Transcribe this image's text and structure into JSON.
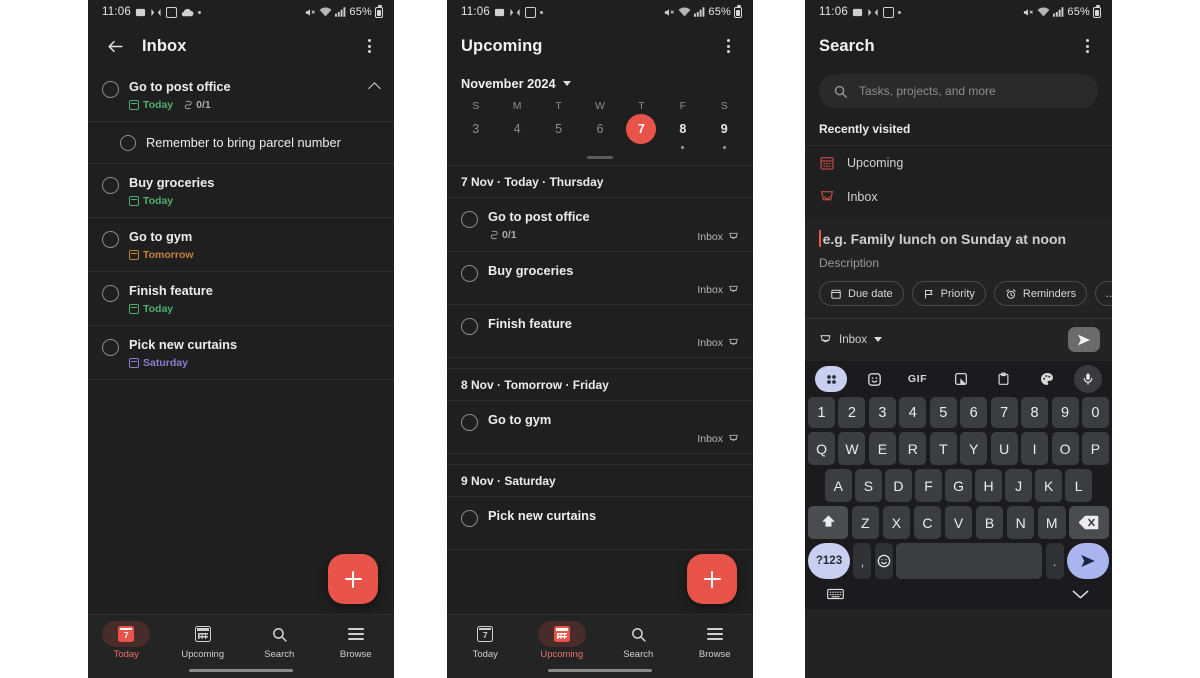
{
  "statusbar": {
    "time": "11:06",
    "battery": "65%",
    "icons": [
      "image-icon",
      "messages-icon",
      "calendar-icon",
      "cloud-icon",
      "dot-icon"
    ],
    "right_icons": [
      "mute-icon",
      "wifi-icon",
      "signal-icon",
      "battery-icon"
    ]
  },
  "panel_inbox": {
    "appbar": {
      "back": "back-arrow-icon",
      "title": "Inbox",
      "menu": "overflow-menu-icon"
    },
    "tasks": [
      {
        "name": "Go to post office",
        "date": "Today",
        "date_color": "green",
        "subcount": "0/1",
        "expanded": true,
        "sub": false
      },
      {
        "name": "Remember to bring parcel number",
        "date": "",
        "date_color": "",
        "subcount": "",
        "expanded": false,
        "sub": true
      },
      {
        "name": "Buy groceries",
        "date": "Today",
        "date_color": "green",
        "subcount": "",
        "expanded": false,
        "sub": false
      },
      {
        "name": "Go to gym",
        "date": "Tomorrow",
        "date_color": "orange",
        "subcount": "",
        "expanded": false,
        "sub": false
      },
      {
        "name": "Finish feature",
        "date": "Today",
        "date_color": "green",
        "subcount": "",
        "expanded": false,
        "sub": false
      },
      {
        "name": "Pick new curtains",
        "date": "Saturday",
        "date_color": "purple",
        "subcount": "",
        "expanded": false,
        "sub": false
      }
    ],
    "fab_label": "+",
    "nav": [
      {
        "label": "Today",
        "icon": "calendar-today-icon",
        "active": true
      },
      {
        "label": "Upcoming",
        "icon": "calendar-grid-icon",
        "active": false
      },
      {
        "label": "Search",
        "icon": "search-icon",
        "active": false
      },
      {
        "label": "Browse",
        "icon": "hamburger-icon",
        "active": false
      }
    ]
  },
  "panel_upcoming": {
    "appbar": {
      "title": "Upcoming",
      "menu": "overflow-menu-icon"
    },
    "calendar": {
      "month": "November 2024",
      "weekdays": [
        "S",
        "M",
        "T",
        "W",
        "T",
        "F",
        "S"
      ],
      "days": [
        {
          "n": "3",
          "selected": false,
          "bright": false,
          "dot": false
        },
        {
          "n": "4",
          "selected": false,
          "bright": false,
          "dot": false
        },
        {
          "n": "5",
          "selected": false,
          "bright": false,
          "dot": false
        },
        {
          "n": "6",
          "selected": false,
          "bright": false,
          "dot": false
        },
        {
          "n": "7",
          "selected": true,
          "bright": true,
          "dot": false
        },
        {
          "n": "8",
          "selected": false,
          "bright": true,
          "dot": true
        },
        {
          "n": "9",
          "selected": false,
          "bright": true,
          "dot": true
        }
      ]
    },
    "groups": [
      {
        "header": "7 Nov · Today · Thursday",
        "tasks": [
          {
            "name": "Go to post office",
            "subcount": "0/1",
            "project": "Inbox"
          },
          {
            "name": "Buy groceries",
            "subcount": "",
            "project": "Inbox"
          },
          {
            "name": "Finish feature",
            "subcount": "",
            "project": "Inbox"
          }
        ]
      },
      {
        "header": "8 Nov · Tomorrow · Friday",
        "tasks": [
          {
            "name": "Go to gym",
            "subcount": "",
            "project": "Inbox"
          }
        ]
      },
      {
        "header": "9 Nov · Saturday",
        "tasks": [
          {
            "name": "Pick new curtains",
            "subcount": "",
            "project": ""
          }
        ]
      }
    ],
    "fab_label": "+",
    "nav": [
      {
        "label": "Today",
        "icon": "calendar-today-icon",
        "active": false
      },
      {
        "label": "Upcoming",
        "icon": "calendar-grid-icon",
        "active": true
      },
      {
        "label": "Search",
        "icon": "search-icon",
        "active": false
      },
      {
        "label": "Browse",
        "icon": "hamburger-icon",
        "active": false
      }
    ]
  },
  "panel_search": {
    "appbar": {
      "title": "Search",
      "menu": "overflow-menu-icon"
    },
    "search": {
      "placeholder": "Tasks, projects, and more",
      "value": ""
    },
    "recently_visited": {
      "header": "Recently visited",
      "items": [
        {
          "label": "Upcoming",
          "icon": "calendar-grid-icon"
        },
        {
          "label": "Inbox",
          "icon": "inbox-icon"
        }
      ]
    },
    "quick_add": {
      "task_placeholder": "e.g. Family lunch on Sunday at noon",
      "description_placeholder": "Description",
      "chips": [
        {
          "label": "Due date",
          "icon": "calendar-icon"
        },
        {
          "label": "Priority",
          "icon": "flag-icon"
        },
        {
          "label": "Reminders",
          "icon": "alarm-icon"
        },
        {
          "label": "…",
          "icon": "more-icon"
        }
      ],
      "project": "Inbox",
      "send": "send-icon"
    },
    "keyboard": {
      "tools": [
        "apps-grid-icon",
        "sticker-icon",
        "GIF",
        "translate-icon",
        "clipboard-icon",
        "theme-icon",
        "mic-icon"
      ],
      "rows": [
        [
          "1",
          "2",
          "3",
          "4",
          "5",
          "6",
          "7",
          "8",
          "9",
          "0"
        ],
        [
          "Q",
          "W",
          "E",
          "R",
          "T",
          "Y",
          "U",
          "I",
          "O",
          "P"
        ],
        [
          "A",
          "S",
          "D",
          "F",
          "G",
          "H",
          "J",
          "K",
          "L"
        ],
        [
          "Z",
          "X",
          "C",
          "V",
          "B",
          "N",
          "M"
        ]
      ],
      "shift": "shift-icon",
      "backspace": "backspace-icon",
      "symbols": "?123",
      "comma": ",",
      "emoji": "emoji-icon",
      "space": "",
      "period": ".",
      "enter": "send-icon",
      "bottom_left": "keyboard-switch-icon",
      "bottom_right": "chevron-down-icon"
    }
  },
  "colors": {
    "accent": "#e8544a",
    "background": "#1f1f1f",
    "green": "#4caf6d",
    "orange": "#c9813a",
    "purple": "#8b7fd4",
    "keyboard_accent": "#aab4ef"
  }
}
